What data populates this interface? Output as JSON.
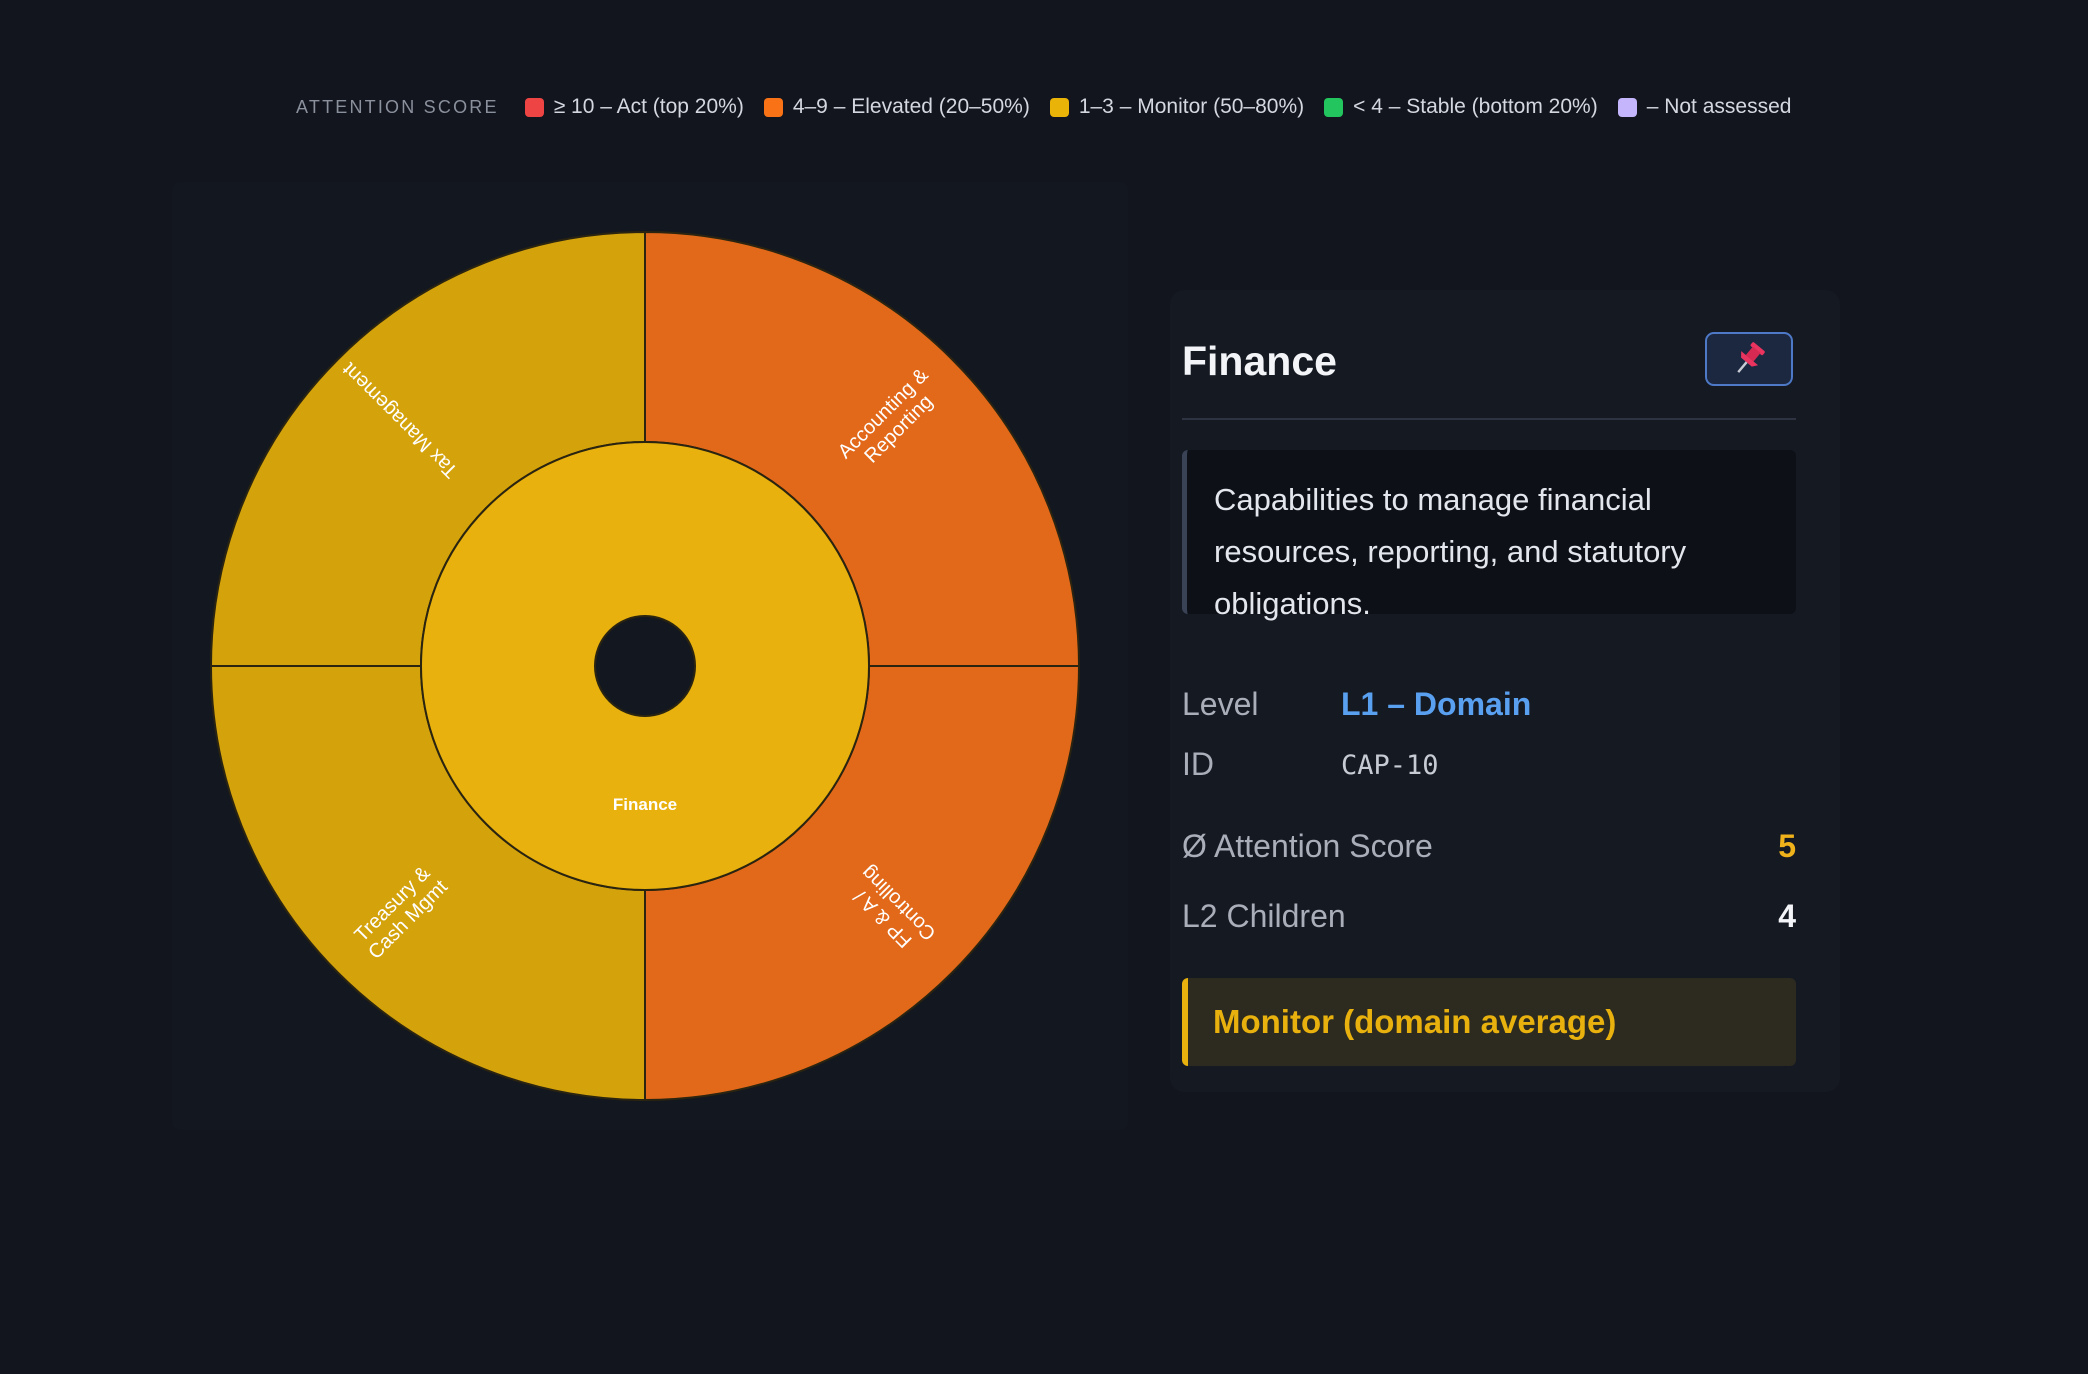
{
  "legend": {
    "title": "ATTENTION SCORE",
    "items": [
      {
        "label": "≥ 10 – Act (top 20%)",
        "color": "#ef4444"
      },
      {
        "label": "4–9 – Elevated (20–50%)",
        "color": "#f97316"
      },
      {
        "label": "1–3 – Monitor (50–80%)",
        "color": "#eab308"
      },
      {
        "label": "< 4 – Stable (bottom 20%)",
        "color": "#22c55e"
      },
      {
        "label": "– Not assessed",
        "color": "#c4b5fd"
      }
    ]
  },
  "chart_data": {
    "type": "sunburst",
    "root": {
      "label": "Finance",
      "score": 5,
      "status": "Monitor",
      "color": "#e8b10d"
    },
    "children": [
      {
        "label": "Accounting & Reporting",
        "lines": [
          "Accounting &",
          "Reporting"
        ],
        "value": 1,
        "status": "Elevated",
        "color": "#e2691a"
      },
      {
        "label": "FP & A / Controlling",
        "lines": [
          "FP & A /",
          "Controlling"
        ],
        "value": 1,
        "status": "Elevated",
        "color": "#e2691a"
      },
      {
        "label": "Treasury & Cash Mgmt",
        "lines": [
          "Treasury &",
          "Cash Mgmt"
        ],
        "value": 1,
        "status": "Monitor",
        "color": "#d4a20b"
      },
      {
        "label": "Tax Management",
        "lines": [
          "Tax Management"
        ],
        "value": 1,
        "status": "Monitor",
        "color": "#d4a20b"
      }
    ]
  },
  "detail": {
    "title": "Finance",
    "pin_icon": "pushpin-icon",
    "description": "Capabilities to manage financial resources, reporting, and statutory obligations.",
    "level_label": "Level",
    "level_value": "L1 – Domain",
    "id_label": "ID",
    "id_value": "CAP-10",
    "score_label": "Ø Attention Score",
    "score_value": "5",
    "children_label": "L2 Children",
    "children_value": "4",
    "status_text": "Monitor (domain average)"
  }
}
